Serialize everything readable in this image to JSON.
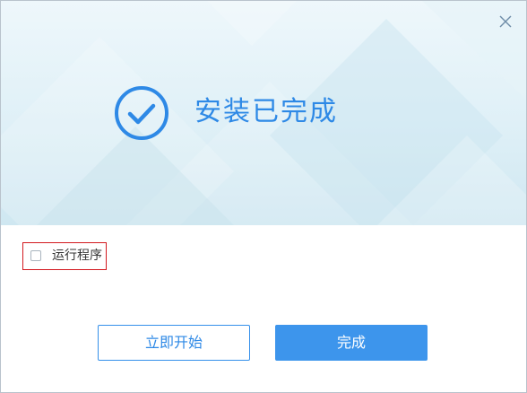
{
  "banner": {
    "title": "安装已完成",
    "icon": "check-circle-icon",
    "accent_color": "#2e89e6"
  },
  "window": {
    "close_icon": "close-icon"
  },
  "option": {
    "label": "运行程序",
    "checked": false
  },
  "buttons": {
    "start_label": "立即开始",
    "finish_label": "完成",
    "primary_color": "#3d95ec"
  }
}
